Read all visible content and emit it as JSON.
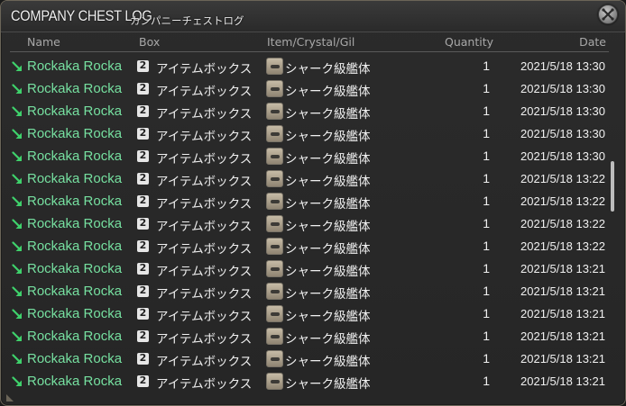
{
  "window": {
    "title": "COMPANY CHEST LOG",
    "subtitle": "カンパニーチェストログ"
  },
  "columns": {
    "name": "Name",
    "box": "Box",
    "item": "Item/Crystal/Gil",
    "quantity": "Quantity",
    "date": "Date"
  },
  "icons": {
    "close": "close-icon",
    "arrow": "deposit-arrow-icon",
    "box": "box-2-icon",
    "item": "submarine-item-icon"
  },
  "colors": {
    "name_text": "#76e0a0",
    "arrow": "#3ed16b",
    "body_text": "#f0f0f0",
    "header_text": "#a8a8a8"
  },
  "box_icon_glyph": "2",
  "rows": [
    {
      "name": "Rockaka Rocka",
      "box": "アイテムボックス",
      "item": "シャーク級艦体",
      "quantity": "1",
      "date": "2021/5/18 13:30"
    },
    {
      "name": "Rockaka Rocka",
      "box": "アイテムボックス",
      "item": "シャーク級艦体",
      "quantity": "1",
      "date": "2021/5/18 13:30"
    },
    {
      "name": "Rockaka Rocka",
      "box": "アイテムボックス",
      "item": "シャーク級艦体",
      "quantity": "1",
      "date": "2021/5/18 13:30"
    },
    {
      "name": "Rockaka Rocka",
      "box": "アイテムボックス",
      "item": "シャーク級艦体",
      "quantity": "1",
      "date": "2021/5/18 13:30"
    },
    {
      "name": "Rockaka Rocka",
      "box": "アイテムボックス",
      "item": "シャーク級艦体",
      "quantity": "1",
      "date": "2021/5/18 13:30"
    },
    {
      "name": "Rockaka Rocka",
      "box": "アイテムボックス",
      "item": "シャーク級艦体",
      "quantity": "1",
      "date": "2021/5/18 13:22"
    },
    {
      "name": "Rockaka Rocka",
      "box": "アイテムボックス",
      "item": "シャーク級艦体",
      "quantity": "1",
      "date": "2021/5/18 13:22"
    },
    {
      "name": "Rockaka Rocka",
      "box": "アイテムボックス",
      "item": "シャーク級艦体",
      "quantity": "1",
      "date": "2021/5/18 13:22"
    },
    {
      "name": "Rockaka Rocka",
      "box": "アイテムボックス",
      "item": "シャーク級艦体",
      "quantity": "1",
      "date": "2021/5/18 13:22"
    },
    {
      "name": "Rockaka Rocka",
      "box": "アイテムボックス",
      "item": "シャーク級艦体",
      "quantity": "1",
      "date": "2021/5/18 13:21"
    },
    {
      "name": "Rockaka Rocka",
      "box": "アイテムボックス",
      "item": "シャーク級艦体",
      "quantity": "1",
      "date": "2021/5/18 13:21"
    },
    {
      "name": "Rockaka Rocka",
      "box": "アイテムボックス",
      "item": "シャーク級艦体",
      "quantity": "1",
      "date": "2021/5/18 13:21"
    },
    {
      "name": "Rockaka Rocka",
      "box": "アイテムボックス",
      "item": "シャーク級艦体",
      "quantity": "1",
      "date": "2021/5/18 13:21"
    },
    {
      "name": "Rockaka Rocka",
      "box": "アイテムボックス",
      "item": "シャーク級艦体",
      "quantity": "1",
      "date": "2021/5/18 13:21"
    },
    {
      "name": "Rockaka Rocka",
      "box": "アイテムボックス",
      "item": "シャーク級艦体",
      "quantity": "1",
      "date": "2021/5/18 13:21"
    }
  ]
}
